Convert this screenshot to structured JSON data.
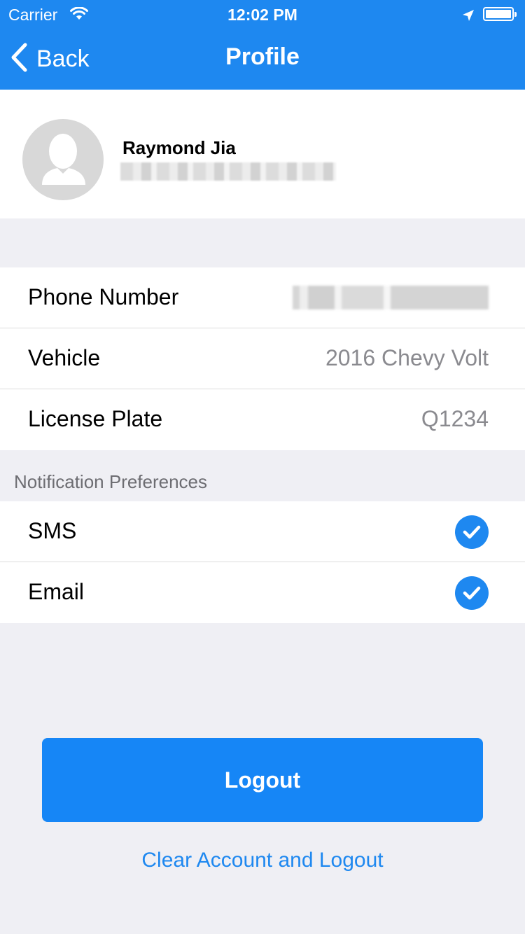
{
  "status_bar": {
    "carrier": "Carrier",
    "time": "12:02 PM",
    "icons": [
      "wifi-icon",
      "location-arrow-icon",
      "battery-icon"
    ]
  },
  "nav": {
    "back_label": "Back",
    "title": "Profile"
  },
  "profile": {
    "name": "Raymond Jia",
    "email": ""
  },
  "details": [
    {
      "label": "Phone Number",
      "value": ""
    },
    {
      "label": "Vehicle",
      "value": "2016 Chevy Volt"
    },
    {
      "label": "License Plate",
      "value": "Q1234"
    }
  ],
  "notifications": {
    "header": "Notification Preferences",
    "items": [
      {
        "label": "SMS",
        "checked": true
      },
      {
        "label": "Email",
        "checked": true
      }
    ]
  },
  "actions": {
    "logout_label": "Logout",
    "clear_label": "Clear Account and Logout"
  },
  "colors": {
    "primary": "#1e88f0",
    "button": "#1686f6",
    "background": "#efeff4"
  }
}
